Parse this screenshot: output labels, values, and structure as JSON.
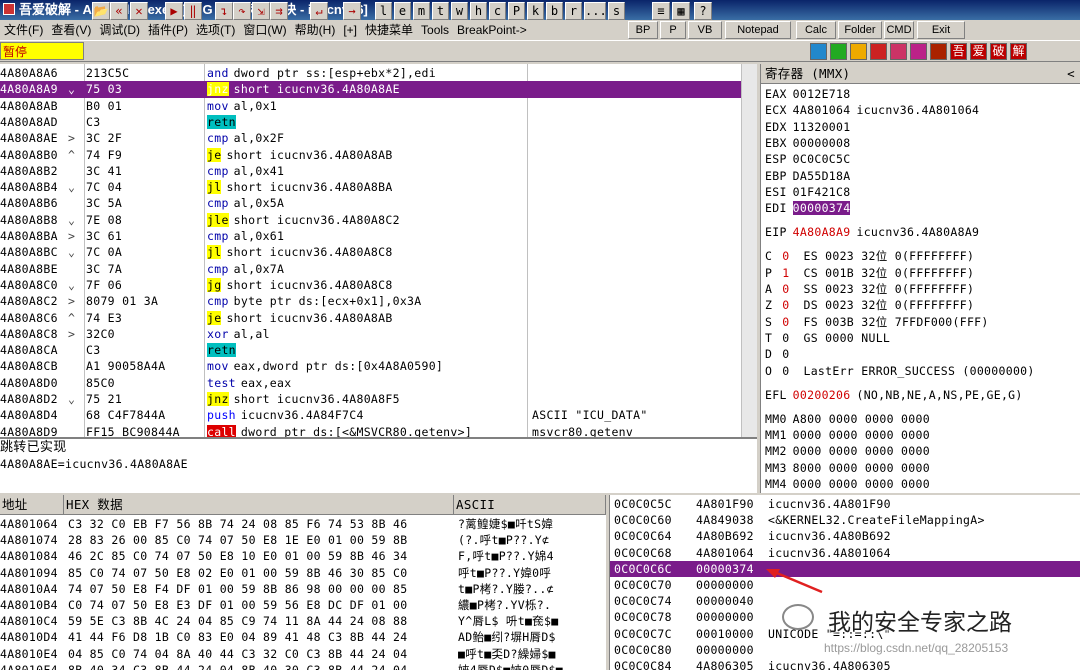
{
  "title": "吾爱破解 - AcroRd32.exe - [LCG - 主线程, 模块 - icucnv36]",
  "menu": [
    "文件(F)",
    "查看(V)",
    "调试(D)",
    "插件(P)",
    "选项(T)",
    "窗口(W)",
    "帮助(H)",
    "[+]",
    "快捷菜单",
    "Tools",
    "BreakPoint->"
  ],
  "right_buttons": [
    "BP",
    "P",
    "VB",
    "Notepad",
    "Calc",
    "Folder",
    "CMD",
    "Exit"
  ],
  "toolbar": {
    "status": "暂停",
    "letters": [
      "l",
      "e",
      "m",
      "t",
      "w",
      "h",
      "c",
      "P",
      "k",
      "b",
      "r",
      "...",
      "s"
    ],
    "colors": [
      "#2288cc",
      "#22aa22",
      "#eeaa00",
      "#cc2222",
      "#cc3366",
      "#bb2288",
      "#aa2200"
    ],
    "chinese": [
      "吾",
      "爱",
      "破",
      "解"
    ]
  },
  "disasm": [
    {
      "addr": "4A80A8A6",
      "ctl": "",
      "hex": "213C5C",
      "mn": "and",
      "op": "dword ptr ss:[esp+ebx*2],edi",
      "cmt": ""
    },
    {
      "addr": "4A80A8A9",
      "ctl": "⌄",
      "hex": "75 03",
      "mn": "jnz",
      "op": "short icucnv36.4A80A8AE",
      "cmt": "",
      "hl": true
    },
    {
      "addr": "4A80A8AB",
      "ctl": "",
      "hex": "B0 01",
      "mn": "mov",
      "op": "al,0x1",
      "cmt": ""
    },
    {
      "addr": "4A80A8AD",
      "ctl": "",
      "hex": "C3",
      "mn": "retn",
      "op": "",
      "cmt": ""
    },
    {
      "addr": "4A80A8AE",
      "ctl": ">",
      "hex": "3C 2F",
      "mn": "cmp",
      "op": "al,0x2F",
      "cmt": ""
    },
    {
      "addr": "4A80A8B0",
      "ctl": "^",
      "hex": "74 F9",
      "mn": "je",
      "op": "short icucnv36.4A80A8AB",
      "cmt": ""
    },
    {
      "addr": "4A80A8B2",
      "ctl": "",
      "hex": "3C 41",
      "mn": "cmp",
      "op": "al,0x41",
      "cmt": ""
    },
    {
      "addr": "4A80A8B4",
      "ctl": "⌄",
      "hex": "7C 04",
      "mn": "jl",
      "op": "short icucnv36.4A80A8BA",
      "cmt": ""
    },
    {
      "addr": "4A80A8B6",
      "ctl": "",
      "hex": "3C 5A",
      "mn": "cmp",
      "op": "al,0x5A",
      "cmt": ""
    },
    {
      "addr": "4A80A8B8",
      "ctl": "⌄",
      "hex": "7E 08",
      "mn": "jle",
      "op": "short icucnv36.4A80A8C2",
      "cmt": ""
    },
    {
      "addr": "4A80A8BA",
      "ctl": ">",
      "hex": "3C 61",
      "mn": "cmp",
      "op": "al,0x61",
      "cmt": ""
    },
    {
      "addr": "4A80A8BC",
      "ctl": "⌄",
      "hex": "7C 0A",
      "mn": "jl",
      "op": "short icucnv36.4A80A8C8",
      "cmt": ""
    },
    {
      "addr": "4A80A8BE",
      "ctl": "",
      "hex": "3C 7A",
      "mn": "cmp",
      "op": "al,0x7A",
      "cmt": ""
    },
    {
      "addr": "4A80A8C0",
      "ctl": "⌄",
      "hex": "7F 06",
      "mn": "jg",
      "op": "short icucnv36.4A80A8C8",
      "cmt": ""
    },
    {
      "addr": "4A80A8C2",
      "ctl": ">",
      "hex": "8079 01 3A",
      "mn": "cmp",
      "op": "byte ptr ds:[ecx+0x1],0x3A",
      "cmt": ""
    },
    {
      "addr": "4A80A8C6",
      "ctl": "^",
      "hex": "74 E3",
      "mn": "je",
      "op": "short icucnv36.4A80A8AB",
      "cmt": ""
    },
    {
      "addr": "4A80A8C8",
      "ctl": ">",
      "hex": "32C0",
      "mn": "xor",
      "op": "al,al",
      "cmt": ""
    },
    {
      "addr": "4A80A8CA",
      "ctl": "",
      "hex": "C3",
      "mn": "retn",
      "op": "",
      "cmt": ""
    },
    {
      "addr": "4A80A8CB",
      "ctl": "",
      "hex": "A1 90058A4A",
      "mn": "mov",
      "op": "eax,dword ptr ds:[0x4A8A0590]",
      "cmt": ""
    },
    {
      "addr": "4A80A8D0",
      "ctl": "",
      "hex": "85C0",
      "mn": "test",
      "op": "eax,eax",
      "cmt": ""
    },
    {
      "addr": "4A80A8D2",
      "ctl": "⌄",
      "hex": "75 21",
      "mn": "jnz",
      "op": "short icucnv36.4A80A8F5",
      "cmt": ""
    },
    {
      "addr": "4A80A8D4",
      "ctl": "",
      "hex": "68 C4F7844A",
      "mn": "push",
      "op": "icucnv36.4A84F7C4",
      "cmt": "ASCII \"ICU_DATA\""
    },
    {
      "addr": "4A80A8D9",
      "ctl": "",
      "hex": "FF15 BC90844A",
      "mn": "call",
      "op": "dword ptr ds:[<&MSVCR80.getenv>]",
      "cmt": "msvcr80.getenv"
    }
  ],
  "info": {
    "line1": "跳转已实现",
    "line2": "4A80A8AE=icucnv36.4A80A8AE"
  },
  "registers": {
    "header": "寄存器 (MMX)",
    "gp": [
      {
        "n": "EAX",
        "v": "0012E718",
        "c": ""
      },
      {
        "n": "ECX",
        "v": "4A801064",
        "c": "icucnv36.4A801064"
      },
      {
        "n": "EDX",
        "v": "11320001",
        "c": ""
      },
      {
        "n": "EBX",
        "v": "00000008",
        "c": ""
      },
      {
        "n": "ESP",
        "v": "0C0C0C5C",
        "c": ""
      },
      {
        "n": "EBP",
        "v": "DA55D18A",
        "c": ""
      },
      {
        "n": "ESI",
        "v": "01F421C8",
        "c": ""
      },
      {
        "n": "EDI",
        "v": "00000374",
        "c": "",
        "hl": true
      }
    ],
    "eip": {
      "n": "EIP",
      "v": "4A80A8A9",
      "c": "icucnv36.4A80A8A9"
    },
    "flags": [
      {
        "f": "C",
        "b": "0",
        "seg": "ES 0023 32位 0(FFFFFFFF)",
        "red": true
      },
      {
        "f": "P",
        "b": "1",
        "seg": "CS 001B 32位 0(FFFFFFFF)",
        "red": true
      },
      {
        "f": "A",
        "b": "0",
        "seg": "SS 0023 32位 0(FFFFFFFF)",
        "red": true
      },
      {
        "f": "Z",
        "b": "0",
        "seg": "DS 0023 32位 0(FFFFFFFF)",
        "red": true
      },
      {
        "f": "S",
        "b": "0",
        "seg": "FS 003B 32位 7FFDF000(FFF)",
        "red": true
      },
      {
        "f": "T",
        "b": "0",
        "seg": "GS 0000 NULL",
        "red": false
      },
      {
        "f": "D",
        "b": "0",
        "seg": "",
        "red": false
      },
      {
        "f": "O",
        "b": "0",
        "seg": "LastErr ERROR_SUCCESS (00000000)",
        "red": false
      }
    ],
    "efl": {
      "n": "EFL",
      "v": "00200206",
      "c": "(NO,NB,NE,A,NS,PE,GE,G)"
    },
    "mm": [
      {
        "n": "MM0",
        "v": "A800 0000 0000 0000"
      },
      {
        "n": "MM1",
        "v": "0000 0000 0000 0000"
      },
      {
        "n": "MM2",
        "v": "0000 0000 0000 0000"
      },
      {
        "n": "MM3",
        "v": "8000 0000 0000 0000"
      },
      {
        "n": "MM4",
        "v": "0000 0000 0000 0000"
      }
    ]
  },
  "dump": {
    "headers": [
      "地址",
      "HEX 数据",
      "ASCII"
    ],
    "rows": [
      {
        "a": "4A801064",
        "h": "C3 32 C0 EB F7 56 8B 74 24 08 85 F6 74 53 8B 46",
        "s": "?蓠鳇婕$■吀tS媁"
      },
      {
        "a": "4A801074",
        "h": "28 83 26 00 85 C0 74 07 50 E8 1E E0 01 00 59 8B",
        "s": "(?.呼t■P??.Y⊄"
      },
      {
        "a": "4A801084",
        "h": "46 2C 85 C0 74 07 50 E8 10 E0 01 00 59 8B 46 34",
        "s": "F,呼t■P??.Y婂4"
      },
      {
        "a": "4A801094",
        "h": "85 C0 74 07 50 E8 02 E0 01 00 59 8B 46 30 85 C0",
        "s": "呼t■P??.Y媁0呼"
      },
      {
        "a": "4A8010A4",
        "h": "74 07 50 E8 F4 DF 01 00 59 8B 86 98 00 00 00 85",
        "s": "t■P栲?.Y媵?..⊄"
      },
      {
        "a": "4A8010B4",
        "h": "C0 74 07 50 E8 E3 DF 01 00 59 56 E8 DC DF 01 00",
        "s": "繷■P栲?.YV栎?."
      },
      {
        "a": "4A8010C4",
        "h": "59 5E C3 8B 4C 24 04 85 C9 74 11 8A 44 24 08 88",
        "s": "Y^脣L$ 呏t■奃$■"
      },
      {
        "a": "4A8010D4",
        "h": "41 44 F6 D8 1B C0 83 E0 04 89 41 48 C3 8B 44 24",
        "s": "AD鲐■纼?塀H脣D$"
      },
      {
        "a": "4A8010E4",
        "h": "04 85 C0 74 04 8A 40 44 C3 32 C0 C3 8B 44 24 04",
        "s": "■呼t■奀D?繰婦$■"
      },
      {
        "a": "4A8010F4",
        "h": "8B 40 34 C3 8B 44 24 04 8B 40 30 C3 8B 44 24 04",
        "s": "婡4脣D$■婡0脣D$■"
      }
    ]
  },
  "stack": [
    {
      "a": "0C0C0C5C",
      "v": "4A801F90",
      "c": "icucnv36.4A801F90"
    },
    {
      "a": "0C0C0C60",
      "v": "4A849038",
      "c": "<&KERNEL32.CreateFileMappingA>"
    },
    {
      "a": "0C0C0C64",
      "v": "4A80B692",
      "c": "icucnv36.4A80B692"
    },
    {
      "a": "0C0C0C68",
      "v": "4A801064",
      "c": "icucnv36.4A801064"
    },
    {
      "a": "0C0C0C6C",
      "v": "00000374",
      "c": "",
      "hl": true
    },
    {
      "a": "0C0C0C70",
      "v": "00000000",
      "c": ""
    },
    {
      "a": "0C0C0C74",
      "v": "00000040",
      "c": ""
    },
    {
      "a": "0C0C0C78",
      "v": "00000000",
      "c": ""
    },
    {
      "a": "0C0C0C7C",
      "v": "00010000",
      "c": "UNICODE \"=::=::\\\""
    },
    {
      "a": "0C0C0C80",
      "v": "00000000",
      "c": ""
    },
    {
      "a": "0C0C0C84",
      "v": "4A806305",
      "c": "icucnv36.4A806305"
    }
  ],
  "watermark": {
    "text": "我的安全专家之路",
    "url": "https://blog.csdn.net/qq_28205153"
  },
  "colors": {
    "highlight": "#7a1c8a",
    "jump": "#ffff00",
    "ret": "#00bfbf",
    "call": "#dd0000",
    "arrow": "#e02020"
  }
}
